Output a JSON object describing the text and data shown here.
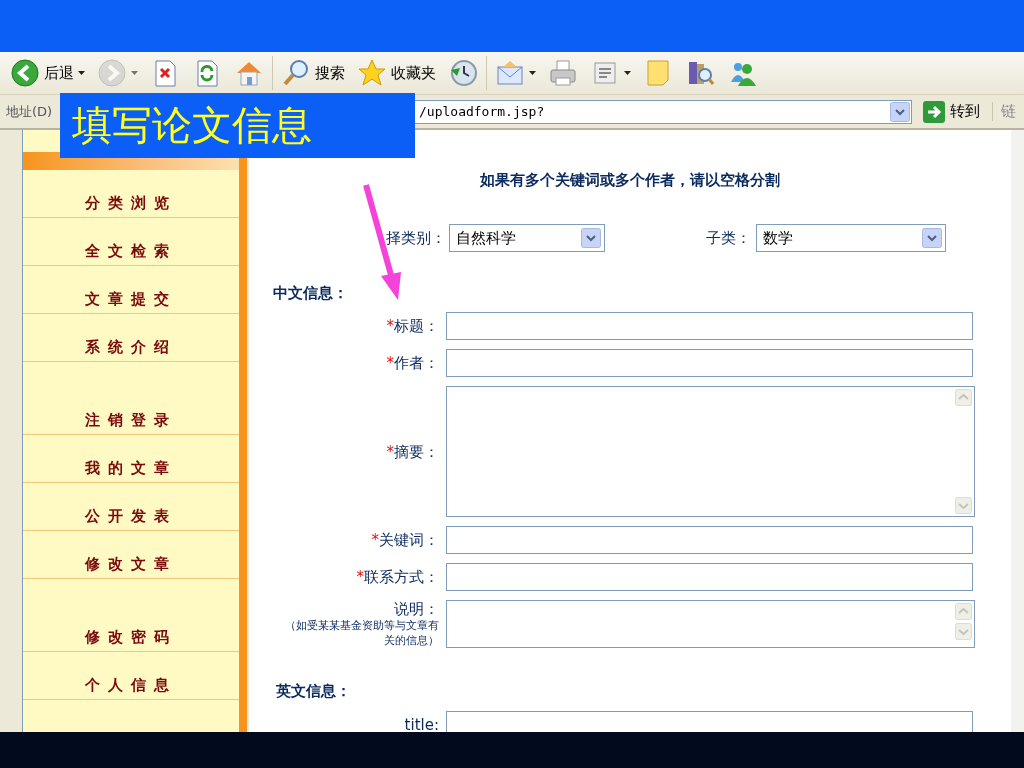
{
  "slide_title": "填写论文信息",
  "toolbar": {
    "groups": [
      {
        "items": [
          {
            "kind": "back",
            "label": "后退",
            "disabled": false
          },
          {
            "kind": "forward",
            "disabled": true
          },
          {
            "kind": "stop",
            "disabled": false
          },
          {
            "kind": "refresh",
            "disabled": false
          },
          {
            "kind": "home",
            "disabled": false
          }
        ]
      },
      {
        "items": [
          {
            "kind": "search",
            "label": "搜索",
            "disabled": false
          },
          {
            "kind": "favorites",
            "label": "收藏夹",
            "disabled": false
          },
          {
            "kind": "history",
            "disabled": false
          }
        ]
      },
      {
        "items": [
          {
            "kind": "mail",
            "disabled": false
          },
          {
            "kind": "print",
            "disabled": false
          },
          {
            "kind": "edit",
            "disabled": false
          },
          {
            "kind": "notes",
            "disabled": false
          },
          {
            "kind": "research",
            "disabled": false
          },
          {
            "kind": "messenger",
            "disabled": false
          }
        ]
      }
    ]
  },
  "address_bar": {
    "label": "地址(D)",
    "url": "/uploadform.jsp?",
    "go": "转到",
    "links": "链"
  },
  "sidebar": {
    "groups": [
      [
        "分类浏览",
        "全文检索",
        "文章提交",
        "系统介绍"
      ],
      [
        "注销登录",
        "我的文章",
        "公开发表",
        "修改文章"
      ],
      [
        "修改密码",
        "个人信息"
      ]
    ]
  },
  "form": {
    "hint": "如果有多个关键词或多个作者，请以空格分割",
    "category": {
      "label": "择类别：",
      "value": "自然科学"
    },
    "subcategory": {
      "label": "子类：",
      "value": "数学"
    },
    "sections": [
      {
        "heading": "中文信息：",
        "fields": [
          {
            "kind": "text",
            "required_mark": "*",
            "label": "标题："
          },
          {
            "kind": "text",
            "required_mark": "*",
            "label": "作者："
          },
          {
            "kind": "area",
            "required_mark": "*",
            "label": "摘要："
          },
          {
            "kind": "text",
            "required_mark": "*",
            "label": "关键词："
          },
          {
            "kind": "text",
            "required_mark": "*",
            "label": "联系方式："
          },
          {
            "kind": "note-area",
            "label": "说明：",
            "note": "（如受某某基金资助等与文章有关的信息）"
          }
        ]
      },
      {
        "heading": "英文信息：",
        "fields": [
          {
            "kind": "text",
            "label": "title:"
          }
        ]
      }
    ]
  }
}
